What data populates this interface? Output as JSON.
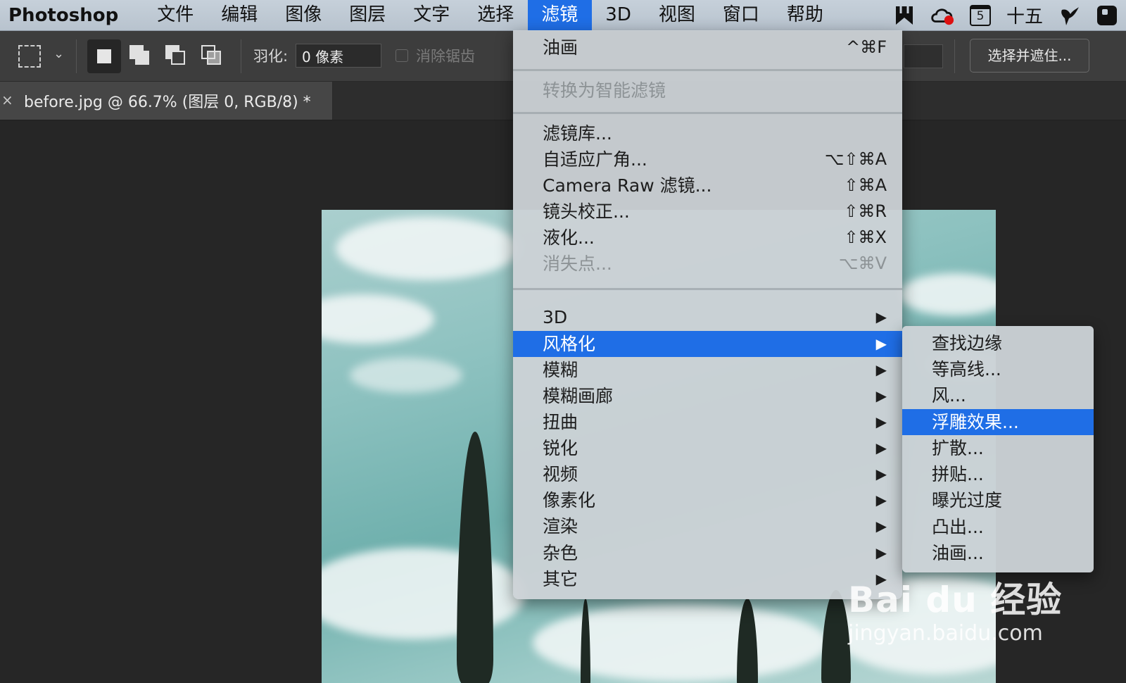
{
  "menubar": {
    "app_name": "Photoshop",
    "items": [
      "文件",
      "编辑",
      "图像",
      "图层",
      "文字",
      "选择",
      "滤镜",
      "3D",
      "视图",
      "窗口",
      "帮助"
    ],
    "active_item": "滤镜",
    "date": "十五",
    "calendar_day": "5"
  },
  "options_bar": {
    "feather_label": "羽化:",
    "feather_value": "0 像素",
    "antialias_label": "消除锯齿",
    "select_mask_label": "选择并遮住..."
  },
  "document_tab": {
    "close": "×",
    "title": "before.jpg @ 66.7% (图层 0, RGB/8) *"
  },
  "filter_menu": {
    "items": [
      {
        "label": "油画",
        "shortcut": "^⌘F"
      },
      {
        "label": "转换为智能滤镜",
        "disabled": true
      },
      {
        "label": "滤镜库..."
      },
      {
        "label": "自适应广角...",
        "shortcut": "⌥⇧⌘A"
      },
      {
        "label": "Camera Raw 滤镜...",
        "shortcut": "⇧⌘A"
      },
      {
        "label": "镜头校正...",
        "shortcut": "⇧⌘R"
      },
      {
        "label": "液化...",
        "shortcut": "⇧⌘X"
      },
      {
        "label": "消失点...",
        "shortcut": "⌥⌘V",
        "disabled": true
      },
      {
        "label": "3D",
        "arrow": "▶"
      },
      {
        "label": "风格化",
        "arrow": "▶",
        "highlight": true
      },
      {
        "label": "模糊",
        "arrow": "▶"
      },
      {
        "label": "模糊画廊",
        "arrow": "▶"
      },
      {
        "label": "扭曲",
        "arrow": "▶"
      },
      {
        "label": "锐化",
        "arrow": "▶"
      },
      {
        "label": "视频",
        "arrow": "▶"
      },
      {
        "label": "像素化",
        "arrow": "▶"
      },
      {
        "label": "渲染",
        "arrow": "▶"
      },
      {
        "label": "杂色",
        "arrow": "▶"
      },
      {
        "label": "其它",
        "arrow": "▶"
      }
    ]
  },
  "stylize_submenu": {
    "items": [
      "查找边缘",
      "等高线...",
      "风...",
      "浮雕效果...",
      "扩散...",
      "拼贴...",
      "曝光过度",
      "凸出...",
      "油画..."
    ],
    "highlighted": "浮雕效果..."
  },
  "watermark": {
    "logo": "Bai du 经验",
    "url": "jingyan.baidu.com"
  },
  "colors": {
    "menubar": "#c6d0da",
    "highlight": "#1f6ee6",
    "options_bar": "#3d3d3d",
    "canvas": "#262626"
  },
  "icons": [
    "apple-menu-icon",
    "marquee-icon",
    "wechat-icon",
    "creative-cloud-icon",
    "calendar-icon",
    "bird-icon",
    "app-icon"
  ]
}
